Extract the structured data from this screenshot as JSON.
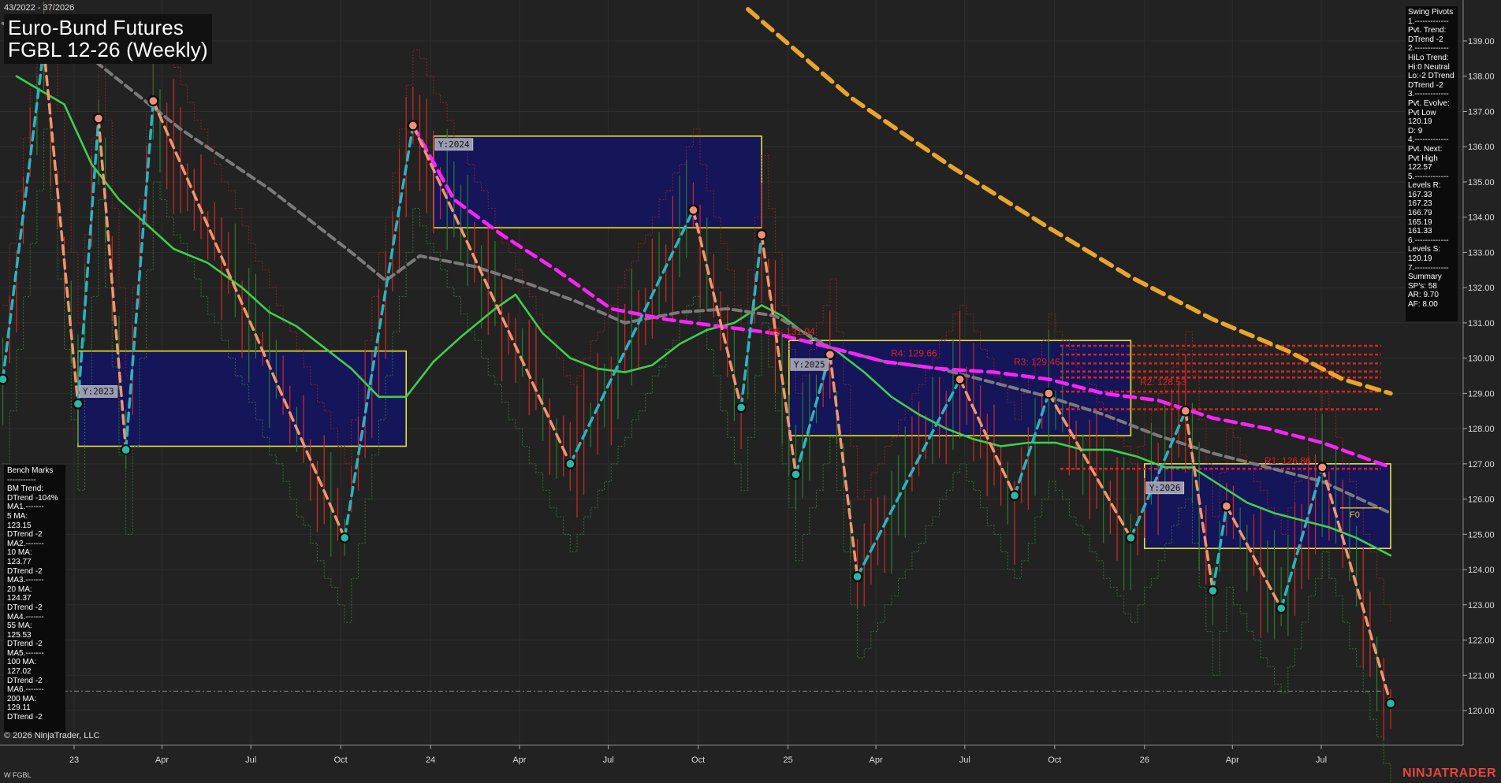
{
  "header": {
    "date_range": "43/2022 - 37/2026",
    "title_line1": "Euro-Bund Futures",
    "title_line2": "FGBL 12-26 (Weekly)"
  },
  "swing_pivots_panel": {
    "lines": [
      "Swing Pivots",
      "1.-------------",
      "Pvt. Trend:",
      "DTrend -2",
      "2.-------------",
      "HiLo Trend:",
      "Hi:0 Neutral",
      "Lo:-2 DTrend",
      "DTrend -2",
      "3.-------------",
      "Pvt. Evolve:",
      "Pvt Low",
      "120.19",
      "D: 9",
      "4.-------------",
      "Pvt. Next:",
      "Pvt High",
      "122.57",
      "5.-------------",
      "Levels R:",
      "167.33",
      "167.23",
      "166.79",
      "165.19",
      "161.33",
      "6.-------------",
      "Levels S:",
      "120.19",
      "7.-------------",
      "Summary",
      "SP's: 58",
      "AR: 9.70",
      "AF: 8.00"
    ]
  },
  "bench_marks_panel": {
    "lines": [
      "Bench Marks",
      "-----------",
      "BM Trend:",
      "DTrend -104%",
      "MA1.-------",
      "5 MA:",
      "123.15",
      "DTrend -2",
      "MA2.-------",
      "10 MA:",
      "123.77",
      "DTrend -2",
      "MA3.-------",
      "20 MA:",
      "124.37",
      "DTrend -2",
      "MA4.-------",
      "55 MA:",
      "125.53",
      "DTrend -2",
      "MA5.-------",
      "100 MA:",
      "127.02",
      "DTrend -2",
      "MA6.-------",
      "200 MA:",
      "129.11",
      "DTrend -2"
    ]
  },
  "footer": {
    "copyright": "© 2026 NinjaTrader, LLC",
    "instrument_tag": "W FGBL",
    "brand": "NINJATRADER"
  },
  "colors": {
    "background": "#222222",
    "grid": "#2e2e2e",
    "up_swing": "#2bb3bf",
    "down_swing": "#f0956e",
    "ma_green": "#3fcf4a",
    "ma_gray": "#7a7a7a",
    "ma_magenta": "#ff22ff",
    "ma_orange": "#e8a52a",
    "price_bar": "#d02a20",
    "box_fill": "#15155a",
    "box_border": "#e6e22a",
    "resistance": "#e02020",
    "pivot_low": "#2ab7a3",
    "pivot_high": "#ef8f78"
  },
  "chart_data": {
    "type": "line",
    "title": "FGBL 12-26 (Weekly)",
    "x_axis": {
      "tick_labels": [
        "23",
        "Apr",
        "Jul",
        "Oct",
        "24",
        "Apr",
        "Jul",
        "Oct",
        "25",
        "Apr",
        "Jul",
        "Oct",
        "26",
        "Apr",
        "Jul"
      ],
      "range": [
        "2022-10",
        "2026-09"
      ]
    },
    "y_axis": {
      "range": [
        119.5,
        139.6
      ],
      "tick_labels": [
        "120.00",
        "121.00",
        "122.00",
        "123.00",
        "124.00",
        "125.00",
        "126.00",
        "127.00",
        "128.00",
        "129.00",
        "130.00",
        "131.00",
        "132.00",
        "133.00",
        "134.00",
        "135.00",
        "136.00",
        "137.00",
        "138.00",
        "139.00"
      ]
    },
    "grid": true,
    "swing_pivots": [
      {
        "date": "2022-10-20",
        "price": 129.4,
        "kind": "low"
      },
      {
        "date": "2022-12-01",
        "price": 138.8,
        "kind": "high"
      },
      {
        "date": "2023-01-05",
        "price": 128.7,
        "kind": "low"
      },
      {
        "date": "2023-01-26",
        "price": 136.8,
        "kind": "high"
      },
      {
        "date": "2023-02-23",
        "price": 127.4,
        "kind": "low"
      },
      {
        "date": "2023-03-23",
        "price": 137.3,
        "kind": "high"
      },
      {
        "date": "2023-10-05",
        "price": 124.9,
        "kind": "low"
      },
      {
        "date": "2023-12-14",
        "price": 136.6,
        "kind": "high"
      },
      {
        "date": "2024-05-23",
        "price": 127.0,
        "kind": "low"
      },
      {
        "date": "2024-09-26",
        "price": 134.2,
        "kind": "high"
      },
      {
        "date": "2024-11-14",
        "price": 128.6,
        "kind": "low"
      },
      {
        "date": "2024-12-05",
        "price": 133.5,
        "kind": "high"
      },
      {
        "date": "2025-01-09",
        "price": 126.7,
        "kind": "low"
      },
      {
        "date": "2025-02-13",
        "price": 130.1,
        "kind": "high"
      },
      {
        "date": "2025-03-13",
        "price": 123.8,
        "kind": "low"
      },
      {
        "date": "2025-06-26",
        "price": 129.4,
        "kind": "high"
      },
      {
        "date": "2025-08-21",
        "price": 126.1,
        "kind": "low"
      },
      {
        "date": "2025-09-25",
        "price": 129.0,
        "kind": "high"
      },
      {
        "date": "2025-12-18",
        "price": 124.9,
        "kind": "low"
      },
      {
        "date": "2026-02-12",
        "price": 128.5,
        "kind": "high"
      },
      {
        "date": "2026-03-12",
        "price": 123.4,
        "kind": "low"
      },
      {
        "date": "2026-03-26",
        "price": 125.8,
        "kind": "high"
      },
      {
        "date": "2026-05-21",
        "price": 122.9,
        "kind": "low"
      },
      {
        "date": "2026-07-02",
        "price": 126.9,
        "kind": "high"
      },
      {
        "date": "2026-09-10",
        "price": 120.2,
        "kind": "low"
      }
    ],
    "year_boxes": [
      {
        "label": "Y:2023",
        "date_start": "2023-01-05",
        "date_end": "2023-12-07",
        "price_high": 130.2,
        "price_low": 127.5
      },
      {
        "label": "Y:2024",
        "date_start": "2024-01-04",
        "date_end": "2024-12-05",
        "price_high": 136.3,
        "price_low": 133.7
      },
      {
        "label": "Y:2025",
        "date_start": "2025-01-02",
        "date_end": "2025-12-18",
        "price_high": 130.5,
        "price_low": 127.8
      },
      {
        "label": "Y:2026",
        "date_start": "2026-01-01",
        "date_end": "2026-09-10",
        "price_high": 127.0,
        "price_low": 124.6
      }
    ],
    "resistance_levels": [
      {
        "label": "R1: 126.86",
        "price": 126.86
      },
      {
        "label": "",
        "price": 128.55
      },
      {
        "label": "R2: 128.53",
        "price": 129.05
      },
      {
        "label": "",
        "price": 129.45
      },
      {
        "label": "R3: 129.46",
        "price": 129.62
      },
      {
        "label": "R4: 129.66",
        "price": 129.85
      },
      {
        "label": "",
        "price": 130.1
      },
      {
        "label": "R5: 131.04",
        "price": 130.35
      }
    ],
    "f0_marker": {
      "label": "F0",
      "price": 125.75
    },
    "last_price_line": 120.55,
    "moving_averages": [
      {
        "name": "20 MA",
        "color": "green",
        "points": [
          [
            "2022-11-03",
            138.0
          ],
          [
            "2022-12-22",
            137.2
          ],
          [
            "2023-01-19",
            135.5
          ],
          [
            "2023-02-16",
            134.5
          ],
          [
            "2023-03-16",
            133.8
          ],
          [
            "2023-04-13",
            133.1
          ],
          [
            "2023-05-18",
            132.7
          ],
          [
            "2023-06-22",
            132.0
          ],
          [
            "2023-07-20",
            131.3
          ],
          [
            "2023-08-17",
            130.9
          ],
          [
            "2023-09-14",
            130.3
          ],
          [
            "2023-10-12",
            129.7
          ],
          [
            "2023-11-09",
            128.9
          ],
          [
            "2023-12-07",
            128.9
          ],
          [
            "2024-01-04",
            129.9
          ],
          [
            "2024-02-01",
            130.6
          ],
          [
            "2024-03-07",
            131.4
          ],
          [
            "2024-03-28",
            131.8
          ],
          [
            "2024-04-25",
            130.7
          ],
          [
            "2024-05-23",
            130.0
          ],
          [
            "2024-06-20",
            129.7
          ],
          [
            "2024-07-18",
            129.6
          ],
          [
            "2024-08-15",
            129.8
          ],
          [
            "2024-09-12",
            130.4
          ],
          [
            "2024-10-10",
            130.8
          ],
          [
            "2024-11-07",
            131.0
          ],
          [
            "2024-12-05",
            131.5
          ],
          [
            "2024-12-26",
            131.2
          ],
          [
            "2025-01-23",
            130.6
          ],
          [
            "2025-02-20",
            130.2
          ],
          [
            "2025-03-20",
            129.6
          ],
          [
            "2025-04-17",
            128.9
          ],
          [
            "2025-05-15",
            128.4
          ],
          [
            "2025-06-12",
            128.0
          ],
          [
            "2025-07-10",
            127.7
          ],
          [
            "2025-08-07",
            127.5
          ],
          [
            "2025-09-04",
            127.6
          ],
          [
            "2025-10-02",
            127.6
          ],
          [
            "2025-10-30",
            127.4
          ],
          [
            "2025-11-27",
            127.4
          ],
          [
            "2025-12-25",
            127.2
          ],
          [
            "2026-01-22",
            126.9
          ],
          [
            "2026-02-19",
            126.9
          ],
          [
            "2026-03-19",
            126.4
          ],
          [
            "2026-04-16",
            125.9
          ],
          [
            "2026-05-14",
            125.6
          ],
          [
            "2026-06-11",
            125.4
          ],
          [
            "2026-07-09",
            125.2
          ],
          [
            "2026-08-06",
            124.9
          ],
          [
            "2026-09-10",
            124.4
          ]
        ]
      },
      {
        "name": "55 MA",
        "color": "gray",
        "points": [
          [
            "2022-10-20",
            139.5
          ],
          [
            "2023-01-19",
            138.5
          ],
          [
            "2023-04-20",
            136.5
          ],
          [
            "2023-07-20",
            134.8
          ],
          [
            "2023-10-12",
            133.0
          ],
          [
            "2023-11-16",
            132.2
          ],
          [
            "2023-12-21",
            132.9
          ],
          [
            "2024-02-15",
            132.6
          ],
          [
            "2024-04-11",
            132.1
          ],
          [
            "2024-05-30",
            131.6
          ],
          [
            "2024-07-18",
            131.0
          ],
          [
            "2024-09-12",
            131.3
          ],
          [
            "2024-10-31",
            131.4
          ],
          [
            "2024-12-19",
            131.2
          ],
          [
            "2025-02-13",
            130.3
          ],
          [
            "2025-04-10",
            129.9
          ],
          [
            "2025-06-05",
            129.7
          ],
          [
            "2025-07-31",
            129.3
          ],
          [
            "2025-09-25",
            128.9
          ],
          [
            "2025-11-20",
            128.4
          ],
          [
            "2026-01-15",
            127.8
          ],
          [
            "2026-03-12",
            127.3
          ],
          [
            "2026-05-07",
            126.9
          ],
          [
            "2026-07-02",
            126.5
          ],
          [
            "2026-09-10",
            125.6
          ]
        ]
      },
      {
        "name": "100 MA",
        "color": "magenta",
        "points": [
          [
            "2023-12-14",
            136.6
          ],
          [
            "2024-01-25",
            134.5
          ],
          [
            "2024-03-14",
            133.5
          ],
          [
            "2024-05-09",
            132.5
          ],
          [
            "2024-07-04",
            131.4
          ],
          [
            "2024-08-29",
            131.1
          ],
          [
            "2024-10-24",
            130.9
          ],
          [
            "2024-12-19",
            130.7
          ],
          [
            "2025-02-13",
            130.3
          ],
          [
            "2025-04-10",
            129.9
          ],
          [
            "2025-06-05",
            129.7
          ],
          [
            "2025-07-31",
            129.6
          ],
          [
            "2025-09-25",
            129.4
          ],
          [
            "2025-11-20",
            129.0
          ],
          [
            "2026-01-15",
            128.8
          ],
          [
            "2026-03-12",
            128.3
          ],
          [
            "2026-05-07",
            128.0
          ],
          [
            "2026-07-02",
            127.6
          ],
          [
            "2026-09-10",
            126.9
          ]
        ]
      },
      {
        "name": "200 MA",
        "color": "orange",
        "points": [
          [
            "2024-11-21",
            139.9
          ],
          [
            "2025-03-06",
            137.4
          ],
          [
            "2025-06-19",
            135.4
          ],
          [
            "2025-09-25",
            133.7
          ],
          [
            "2025-12-18",
            132.3
          ],
          [
            "2026-03-12",
            131.1
          ],
          [
            "2026-05-28",
            130.2
          ],
          [
            "2026-07-23",
            129.4
          ],
          [
            "2026-09-10",
            129.0
          ]
        ]
      }
    ]
  }
}
